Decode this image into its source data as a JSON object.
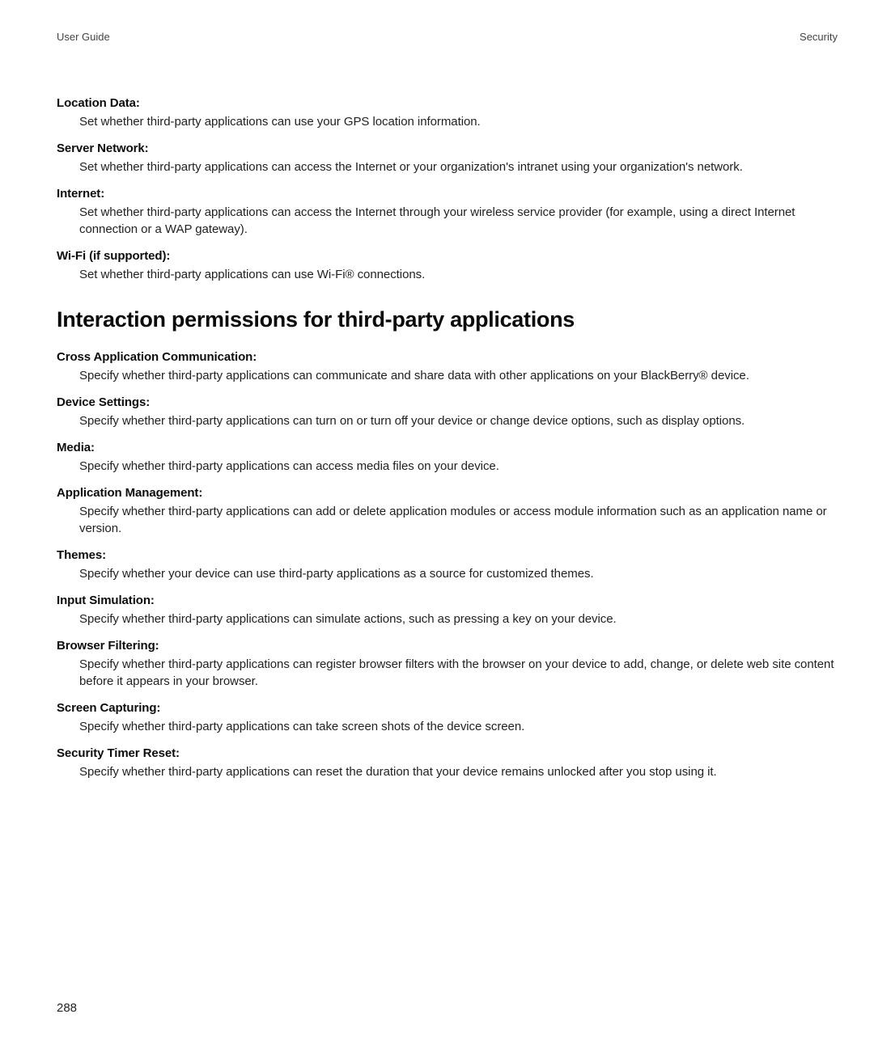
{
  "header": {
    "left": "User Guide",
    "right": "Security"
  },
  "section1": {
    "items": [
      {
        "term": "Location Data:",
        "desc": "Set whether third-party applications can use your GPS location information."
      },
      {
        "term": "Server Network:",
        "desc": "Set whether third-party applications can access the Internet or your organization's intranet using your organization's network."
      },
      {
        "term": "Internet:",
        "desc": "Set whether third-party applications can access the Internet through your wireless service provider (for example, using a direct Internet connection or a WAP gateway)."
      },
      {
        "term": "Wi-Fi (if supported):",
        "desc": "Set whether third-party applications can use Wi-Fi® connections."
      }
    ]
  },
  "section2": {
    "title": "Interaction permissions for third-party applications",
    "items": [
      {
        "term": "Cross Application Communication:",
        "desc": "Specify whether third-party applications can communicate and share data with other applications on your BlackBerry® device."
      },
      {
        "term": "Device Settings:",
        "desc": "Specify whether third-party applications can turn on or turn off your device or change device options, such as display options."
      },
      {
        "term": "Media:",
        "desc": "Specify whether third-party applications can access media files on your device."
      },
      {
        "term": "Application Management:",
        "desc": "Specify whether third-party applications can add or delete application modules or access module information such as an application name or version."
      },
      {
        "term": "Themes:",
        "desc": "Specify whether your device can use third-party applications as a source for customized themes."
      },
      {
        "term": "Input Simulation:",
        "desc": "Specify whether third-party applications can simulate actions, such as pressing a key on your device."
      },
      {
        "term": "Browser Filtering:",
        "desc": "Specify whether third-party applications can register browser filters with the browser on your device to add, change, or delete web site content before it appears in your browser."
      },
      {
        "term": "Screen Capturing:",
        "desc": "Specify whether third-party applications can take screen shots of the device screen."
      },
      {
        "term": "Security Timer Reset:",
        "desc": "Specify whether third-party applications can reset the duration that your device remains unlocked after you stop using it."
      }
    ]
  },
  "pageNumber": "288"
}
